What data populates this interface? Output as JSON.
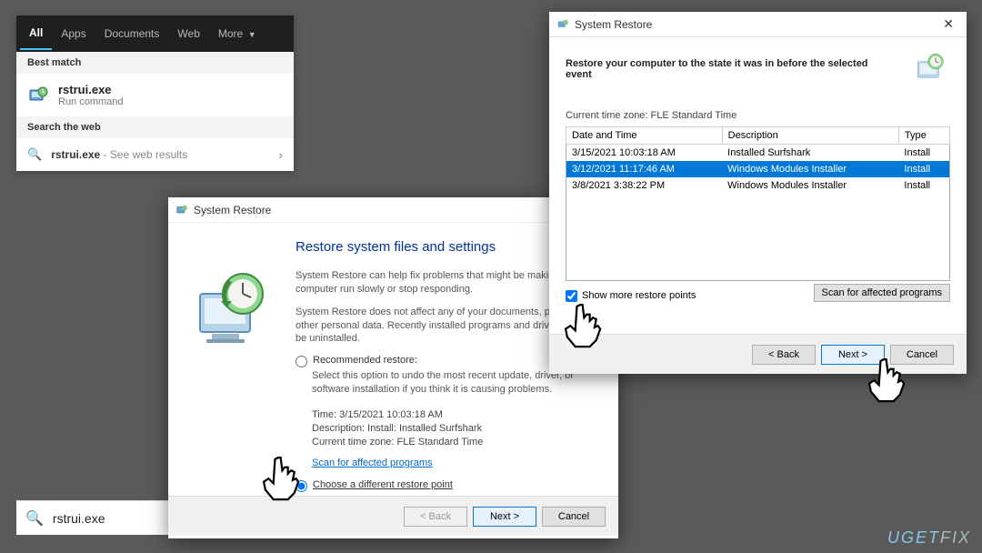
{
  "search": {
    "tabs": [
      "All",
      "Apps",
      "Documents",
      "Web",
      "More"
    ],
    "best_match_header": "Best match",
    "item_title": "rstrui.exe",
    "item_sub": "Run command",
    "web_header": "Search the web",
    "web_item": "rstrui.exe",
    "web_sub": " - See web results",
    "input_value": "rstrui.exe"
  },
  "wiz1": {
    "title": "System Restore",
    "heading": "Restore system files and settings",
    "p1": "System Restore can help fix problems that might be making your computer run slowly or stop responding.",
    "p2": "System Restore does not affect any of your documents, pictures, or other personal data. Recently installed programs and drivers might be uninstalled.",
    "opt_recommended": "Recommended restore:",
    "opt_rec_sub": "Select this option to undo the most recent update, driver, or software installation if you think it is causing problems.",
    "time": "Time: 3/15/2021 10:03:18 AM",
    "desc": "Description: Install: Installed Surfshark",
    "tz": "Current time zone: FLE Standard Time",
    "scan_link": "Scan for affected programs",
    "opt_diff": "Choose a different restore point",
    "back": "< Back",
    "next": "Next >",
    "cancel": "Cancel"
  },
  "wiz2": {
    "title": "System Restore",
    "heading": "Restore your computer to the state it was in before the selected event",
    "tz": "Current time zone: FLE Standard Time",
    "cols": {
      "c1": "Date and Time",
      "c2": "Description",
      "c3": "Type"
    },
    "rows": [
      {
        "dt": "3/15/2021 10:03:18 AM",
        "desc": "Installed Surfshark",
        "type": "Install"
      },
      {
        "dt": "3/12/2021 11:17:46 AM",
        "desc": "Windows Modules Installer",
        "type": "Install"
      },
      {
        "dt": "3/8/2021 3:38:22 PM",
        "desc": "Windows Modules Installer",
        "type": "Install"
      }
    ],
    "chk": "Show more restore points",
    "scan_btn": "Scan for affected programs",
    "back": "< Back",
    "next": "Next >",
    "cancel": "Cancel"
  },
  "watermark": {
    "a": "UGET",
    "b": "FIX"
  }
}
